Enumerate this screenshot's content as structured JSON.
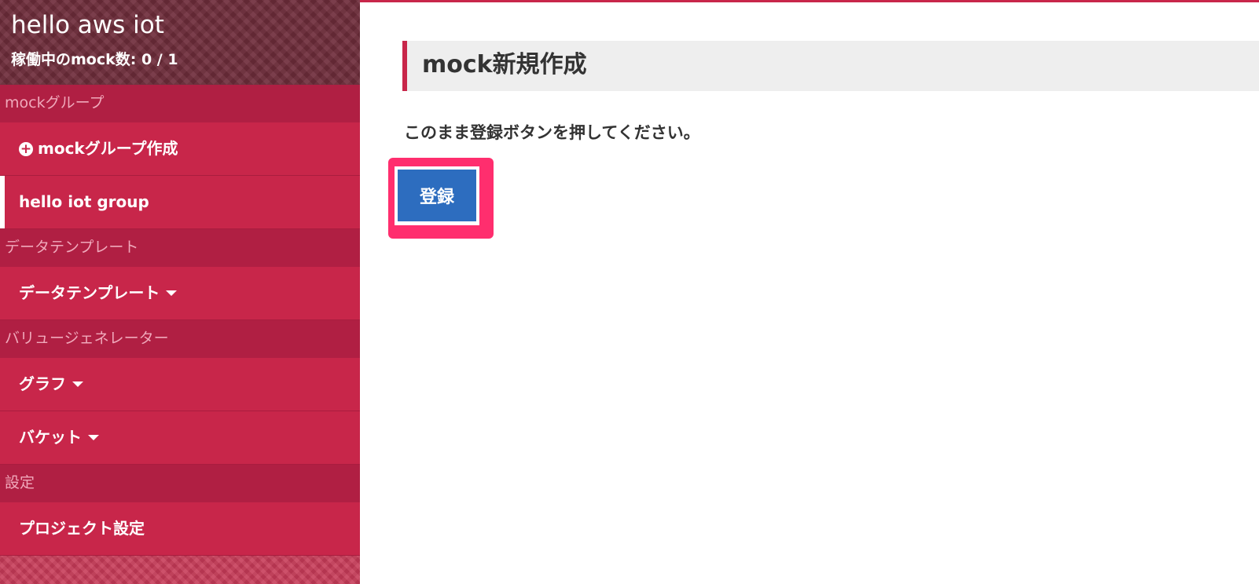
{
  "header": {
    "app_title": "hello aws iot",
    "running_count": "稼働中のmock数: 0 / 1"
  },
  "sidebar": {
    "sections": [
      {
        "title": "mockグループ",
        "items": [
          {
            "label": "mockグループ作成",
            "icon": "plus-circle-icon"
          },
          {
            "label": "hello iot group",
            "active": true
          }
        ]
      },
      {
        "title": "データテンプレート",
        "items": [
          {
            "label": "データテンプレート",
            "icon": "caret-down-icon"
          }
        ]
      },
      {
        "title": "バリュージェネレーター",
        "items": [
          {
            "label": "グラフ",
            "icon": "caret-down-icon"
          },
          {
            "label": "バケット",
            "icon": "caret-down-icon"
          }
        ]
      },
      {
        "title": "設定",
        "items": [
          {
            "label": "プロジェクト設定"
          }
        ]
      }
    ]
  },
  "main": {
    "page_title": "mock新規作成",
    "instruction": "このまま登録ボタンを押してください。",
    "register_label": "登録"
  },
  "colors": {
    "sidebar_bg": "#c8264a",
    "section_bg": "#b01f43",
    "button_blue": "#2d6dbf",
    "highlight": "#ff2e6e"
  }
}
